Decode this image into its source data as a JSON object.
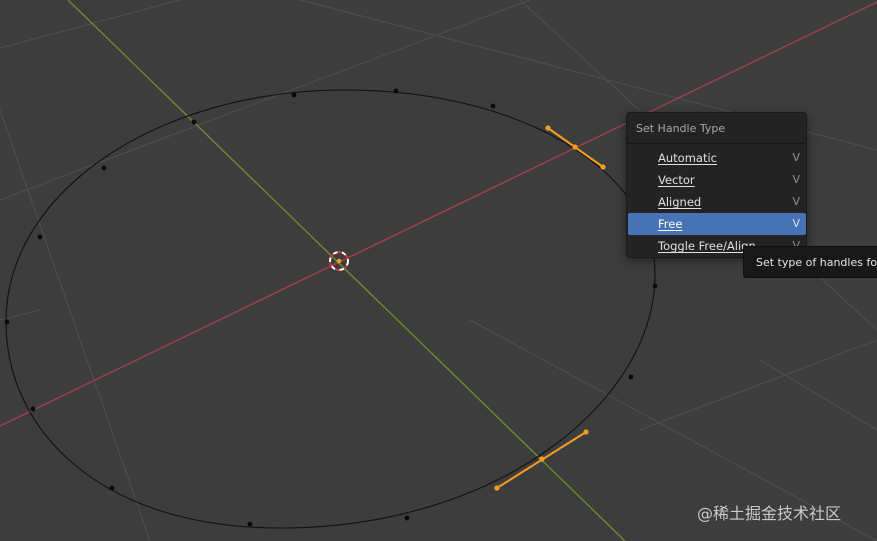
{
  "menu": {
    "title": "Set Handle Type",
    "items": [
      {
        "label": "Automatic",
        "shortcut": "V",
        "active": false
      },
      {
        "label": "Vector",
        "shortcut": "V",
        "active": false
      },
      {
        "label": "Aligned",
        "shortcut": "V",
        "active": false
      },
      {
        "label": "Free",
        "shortcut": "V",
        "active": true
      },
      {
        "label": "Toggle Free/Align",
        "shortcut": "V",
        "active": false
      }
    ]
  },
  "tooltip": {
    "text": "Set type of handles for se"
  },
  "watermark": {
    "text": "@稀土掘金技术社区"
  },
  "colors": {
    "viewport_bg": "#3d3d3d",
    "grid": "#4f4f4f",
    "x_axis": "#a3414e",
    "y_axis": "#6e8a2c",
    "curve": "#111111",
    "selected_handle": "#f29d1f",
    "menu_highlight": "#4772b3"
  }
}
